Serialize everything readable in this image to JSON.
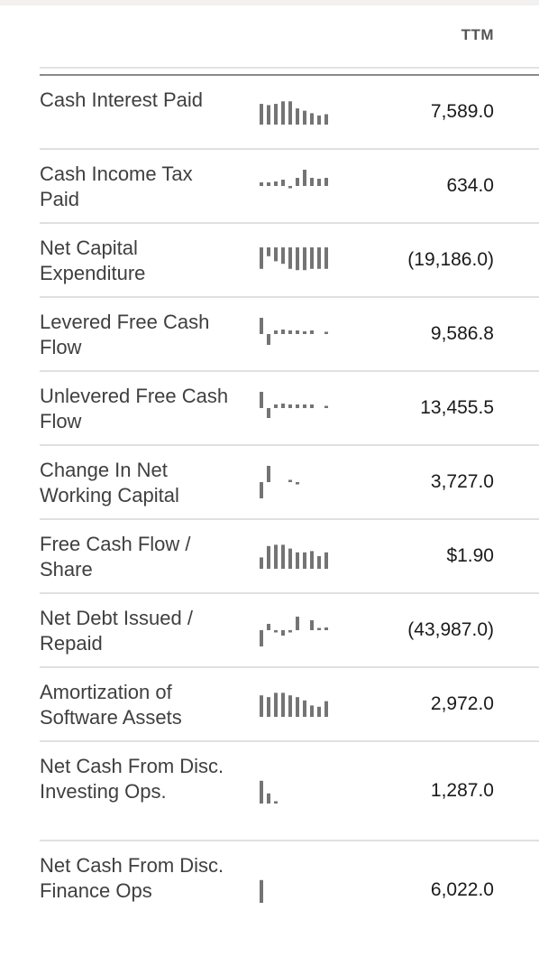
{
  "header": {
    "period_label": "TTM"
  },
  "colors": {
    "bar": "#747474",
    "label": "#3f3f3f",
    "value": "#1a1a1a",
    "divider": "#e0e0e0"
  },
  "rows": [
    {
      "label": "Cash Interest Paid",
      "value": "7,589.0",
      "spark": [
        0.82,
        0.77,
        0.82,
        0.92,
        0.92,
        0.64,
        0.55,
        0.45,
        0.36,
        0.41
      ]
    },
    {
      "label": "Cash Income Tax Paid",
      "value": "634.0",
      "spark": [
        0.2,
        0.2,
        0.25,
        0.35,
        -0.08,
        0.45,
        0.9,
        0.45,
        0.4,
        0.45
      ]
    },
    {
      "label": "Net Capital Expenditure",
      "value": "(19,186.0)",
      "spark": [
        -0.85,
        -0.35,
        -0.55,
        -0.65,
        -0.85,
        -0.9,
        -0.9,
        -0.85,
        -0.85,
        -0.85
      ]
    },
    {
      "label": "Levered Free Cash Flow",
      "value": "9,586.8",
      "spark": [
        0.9,
        -0.6,
        0.2,
        0.25,
        0.2,
        0.2,
        0.15,
        0.2,
        null,
        0.07
      ]
    },
    {
      "label": "Unlevered Free Cash Flow",
      "value": "13,455.5",
      "spark": [
        0.9,
        -0.55,
        0.2,
        0.25,
        0.2,
        0.2,
        0.2,
        0.2,
        null,
        0.07
      ]
    },
    {
      "label": "Change In Net Working Capital",
      "value": "3,727.0",
      "spark": [
        -0.9,
        0.9,
        null,
        null,
        0.05,
        -0.05,
        null,
        null,
        null,
        null
      ]
    },
    {
      "label": "Free Cash Flow / Share",
      "value": "$1.90",
      "spark": [
        0.45,
        0.9,
        0.95,
        0.95,
        0.8,
        0.65,
        0.65,
        0.7,
        0.5,
        0.65
      ]
    },
    {
      "label": "Net Debt Issued / Repaid",
      "value": "(43,987.0)",
      "spark": [
        -0.9,
        0.35,
        -0.1,
        -0.3,
        -0.12,
        0.75,
        null,
        0.55,
        0.05,
        0.15
      ]
    },
    {
      "label": "Amortization of Software Assets",
      "value": "2,972.0",
      "spark": [
        0.85,
        0.78,
        0.95,
        0.95,
        0.85,
        0.78,
        0.65,
        0.45,
        0.4,
        0.62
      ]
    },
    {
      "label": "Net Cash From Disc. Investing Ops.",
      "value": "1,287.0",
      "spark": [
        0.9,
        0.4,
        0.05,
        null,
        null,
        null,
        null,
        null,
        null,
        null
      ]
    },
    {
      "label": "Net Cash From Disc. Finance Ops",
      "value": "6,022.0",
      "spark": [
        0.9,
        null,
        null,
        null,
        null,
        null,
        null,
        null,
        null,
        null
      ]
    }
  ]
}
